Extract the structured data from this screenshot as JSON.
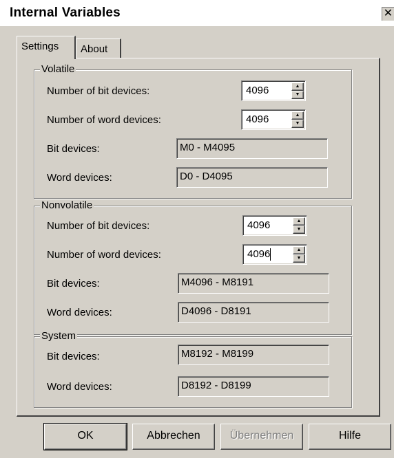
{
  "window": {
    "title": "Internal Variables",
    "close_glyph": "✕"
  },
  "tabs": [
    {
      "label": "Settings",
      "active": true
    },
    {
      "label": "About",
      "active": false
    }
  ],
  "volatile": {
    "group_label": "Volatile",
    "num_bit_label": "Number of bit devices:",
    "num_bit_value": "4096",
    "num_word_label": "Number of word devices:",
    "num_word_value": "4096",
    "bit_label": "Bit devices:",
    "bit_value": "M0 - M4095",
    "word_label": "Word devices:",
    "word_value": "D0 - D4095"
  },
  "nonvolatile": {
    "group_label": "Nonvolatile",
    "num_bit_label": "Number of bit devices:",
    "num_bit_value": "4096",
    "num_word_label": "Number of word devices:",
    "num_word_value": "4096",
    "bit_label": "Bit devices:",
    "bit_value": "M4096 - M8191",
    "word_label": "Word devices:",
    "word_value": "D4096 - D8191"
  },
  "system": {
    "group_label": "System",
    "bit_label": "Bit devices:",
    "bit_value": "M8192 - M8199",
    "word_label": "Word devices:",
    "word_value": "D8192 - D8199"
  },
  "buttons": {
    "ok": "OK",
    "cancel": "Abbrechen",
    "apply": "Übernehmen",
    "help": "Hilfe"
  },
  "icons": {
    "spin_up": "▲",
    "spin_down": "▼"
  }
}
